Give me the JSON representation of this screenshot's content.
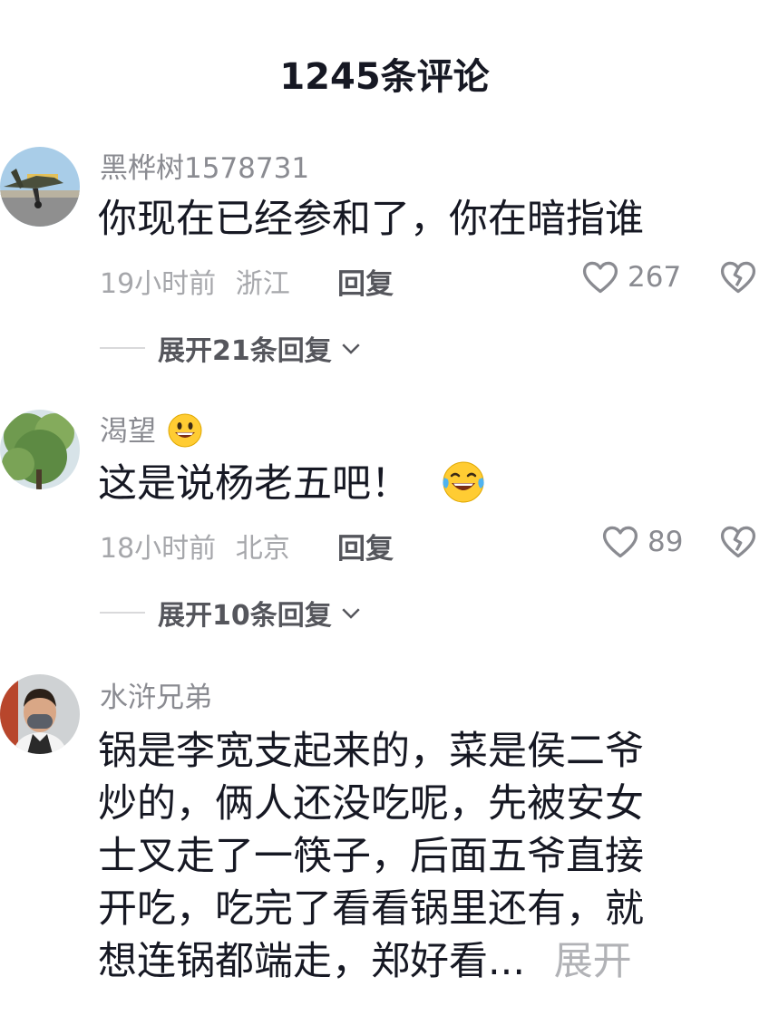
{
  "header": {
    "title": "1245条评论"
  },
  "comments": [
    {
      "username": "黑桦树1578731",
      "text": "你现在已经参和了，你在暗指谁",
      "time": "19小时前",
      "location": "浙江",
      "reply_label": "回复",
      "likes": "267",
      "expand_label": "展开21条回复"
    },
    {
      "username": "渴望",
      "username_emoji": "grinning-face-emoji",
      "text": "这是说杨老五吧！",
      "text_emoji": "crying-laughing-emoji",
      "time": "18小时前",
      "location": "北京",
      "reply_label": "回复",
      "likes": "89",
      "expand_label": "展开10条回复"
    },
    {
      "username": "水浒兄弟",
      "lines": [
        "锅是李宽支起来的，菜是侯二爷",
        "炒的，俩人还没吃呢，先被安女",
        "士叉走了一筷子，后面五爷直接",
        "开吃，吃完了看看锅里还有，就",
        "想连锅都端走，郑好看..."
      ],
      "more_label": "展开"
    }
  ],
  "icons": {
    "like": "heart-outline-icon",
    "dislike": "broken-heart-icon",
    "expand": "chevron-down-icon"
  },
  "colors": {
    "text_primary": "#161823",
    "text_secondary": "#8a8b91",
    "text_meta": "#a6a7ab"
  }
}
